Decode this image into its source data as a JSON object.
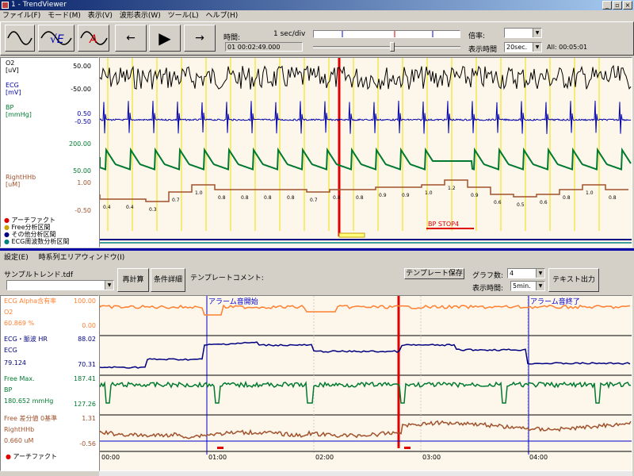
{
  "window": {
    "title": "1 - TrendViewer"
  },
  "menu": [
    "ファイル(F)",
    "モード(M)",
    "表示(V)",
    "波形表示(W)",
    "ツール(L)",
    "ヘルプ(H)"
  ],
  "toolbar": {
    "prev_label": "←",
    "play_label": "▶",
    "next_label": "→",
    "time_label": "時間:",
    "time_value": "01 00:02:49.000",
    "div_label": "1 sec/div",
    "zoom_label": "倍率:",
    "zoom_value": "",
    "disp_label": "表示時間",
    "disp_value": "20sec.",
    "all_label": "All: 00:05:01"
  },
  "upper": {
    "channels": [
      {
        "name": "O2",
        "unit": "[uV]",
        "color": "#000000",
        "ticks": [
          "50.00",
          "-50.00"
        ]
      },
      {
        "name": "ECG",
        "unit": "[mV]",
        "color": "#0000aa",
        "ticks": [
          "0.50",
          "-0.50"
        ]
      },
      {
        "name": "BP",
        "unit": "[mmHg]",
        "color": "#007a30",
        "ticks": [
          "200.00",
          "50.00"
        ]
      },
      {
        "name": "RightHHb",
        "unit": "[uM]",
        "color": "#a0522d",
        "ticks": [
          "1.00",
          "-0.50"
        ]
      }
    ],
    "legend": [
      {
        "label": "アーチファクト",
        "color": "#e00000"
      },
      {
        "label": "Free分析区間",
        "color": "#c8a000"
      },
      {
        "label": "その他分析区間",
        "color": "#000080"
      },
      {
        "label": "ECG周波数分析区間",
        "color": "#008080"
      }
    ],
    "bp_stop": "BP STOP4",
    "hhb_values": [
      "0.4",
      "0.4",
      "0.3",
      "0.7",
      "1.0",
      "0.8",
      "0.8",
      "0.8",
      "0.8",
      "0.7",
      "0.8",
      "0.8",
      "0.9",
      "0.9",
      "1.0",
      "1.2",
      "0.9",
      "0.6",
      "0.5",
      "0.6",
      "0.8",
      "1.0",
      "0.8"
    ]
  },
  "subbar": {
    "items": [
      "設定(E)",
      "時系列エリアウィンドウ(I)"
    ]
  },
  "lower_toolbar": {
    "file_name": "サンプルトレンド.tdf",
    "recalc": "再計算",
    "detail": "条件詳細",
    "comment_label": "テンプレートコメント:",
    "save_template": "テンプレート保存",
    "graph_count_label": "グラフ数:",
    "graph_count_value": "4",
    "disp_time_label": "表示時間:",
    "disp_time_value": "5min.",
    "text_output": "テキスト出力"
  },
  "lower": {
    "channels": [
      {
        "name": "ECG Alpha含有率",
        "src": "O2",
        "value": "60.869 %",
        "color": "#ff8030",
        "ticks": [
          "100.00",
          "0.00"
        ]
      },
      {
        "name": "ECG・脈波 HR",
        "src": "ECG",
        "value": "79.124",
        "color": "#000080",
        "ticks": [
          "88.02",
          "70.31"
        ]
      },
      {
        "name": "Free Max.",
        "src": "BP",
        "value": "180.652 mmHg",
        "color": "#007a30",
        "ticks": [
          "187.41",
          "127.26"
        ]
      },
      {
        "name": "Free 差分値 0基準",
        "src": "RightHHb",
        "value": "0.660 uM",
        "color": "#a0522d",
        "ticks": [
          "1.31",
          "-0.56"
        ]
      }
    ],
    "artifact_label": "アーチファクト",
    "alarm_start": "アラーム音開始",
    "alarm_end": "アラーム音終了",
    "time_ticks": [
      "00:00",
      "01:00",
      "02:00",
      "03:00",
      "04:00"
    ]
  }
}
